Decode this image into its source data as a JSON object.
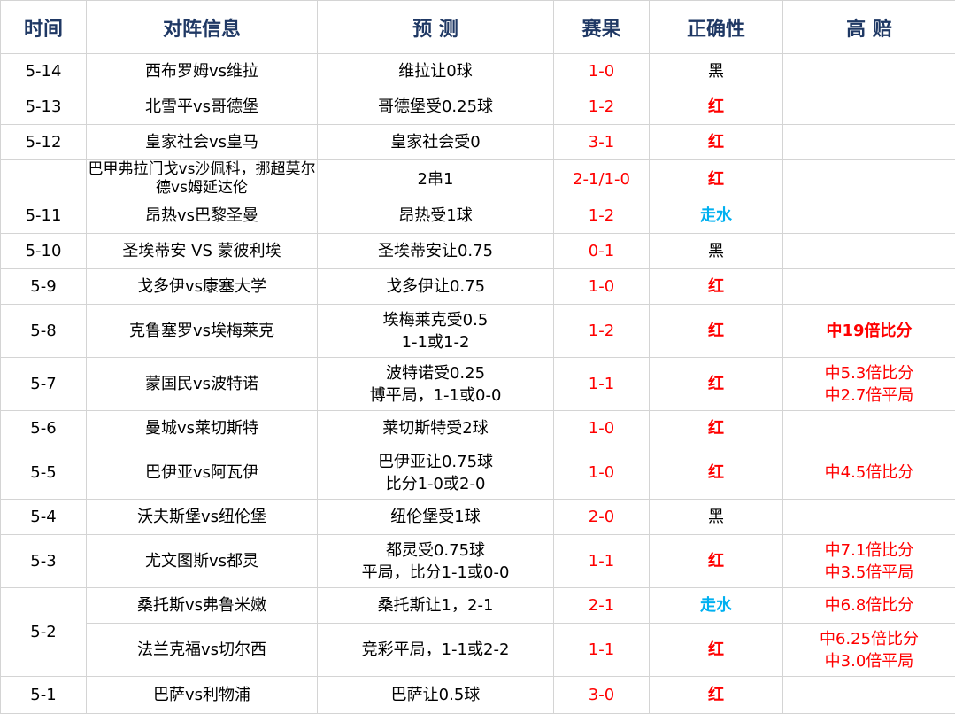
{
  "headers": {
    "time": "时间",
    "match": "对阵信息",
    "prediction": "预 测",
    "score": "赛果",
    "correctness": "正确性",
    "high_odds": "高 赔"
  },
  "rows": [
    {
      "date": "5-14",
      "match": "西布罗姆vs维拉",
      "prediction": [
        "维拉让0球"
      ],
      "score": "1-0",
      "result": "黑",
      "odds": []
    },
    {
      "date": "5-13",
      "match": "北雪平vs哥德堡",
      "prediction": [
        "哥德堡受0.25球"
      ],
      "score": "1-2",
      "result": "红",
      "odds": []
    },
    {
      "date": "5-12",
      "match": "皇家社会vs皇马",
      "prediction": [
        "皇家社会受0"
      ],
      "score": "3-1",
      "result": "红",
      "odds": []
    },
    {
      "date": "",
      "match": "巴甲弗拉门戈vs沙佩科，挪超莫尔德vs姆延达伦",
      "prediction": [
        "2串1"
      ],
      "score": "2-1/1-0",
      "result": "红",
      "odds": []
    },
    {
      "date": "5-11",
      "match": "昂热vs巴黎圣曼",
      "prediction": [
        "昂热受1球"
      ],
      "score": "1-2",
      "result": "走水",
      "odds": []
    },
    {
      "date": "5-10",
      "match": "圣埃蒂安 VS 蒙彼利埃",
      "prediction": [
        "圣埃蒂安让0.75"
      ],
      "score": "0-1",
      "result": "黑",
      "odds": []
    },
    {
      "date": "5-9",
      "match": "戈多伊vs康塞大学",
      "prediction": [
        "戈多伊让0.75"
      ],
      "score": "1-0",
      "result": "红",
      "odds": []
    },
    {
      "date": "5-8",
      "match": "克鲁塞罗vs埃梅莱克",
      "prediction": [
        "埃梅莱克受0.5",
        "1-1或1-2"
      ],
      "score": "1-2",
      "result": "红",
      "odds": [
        "中19倍比分"
      ],
      "odds_bold": true
    },
    {
      "date": "5-7",
      "match": "蒙国民vs波特诺",
      "prediction": [
        "波特诺受0.25",
        "博平局，1-1或0-0"
      ],
      "score": "1-1",
      "result": "红",
      "odds": [
        "中5.3倍比分",
        "中2.7倍平局"
      ]
    },
    {
      "date": "5-6",
      "match": "曼城vs莱切斯特",
      "prediction": [
        "莱切斯特受2球"
      ],
      "score": "1-0",
      "result": "红",
      "odds": []
    },
    {
      "date": "5-5",
      "match": "巴伊亚vs阿瓦伊",
      "prediction": [
        "巴伊亚让0.75球",
        "比分1-0或2-0"
      ],
      "score": "1-0",
      "result": "红",
      "odds": [
        "中4.5倍比分"
      ]
    },
    {
      "date": "5-4",
      "match": "沃夫斯堡vs纽伦堡",
      "prediction": [
        "纽伦堡受1球"
      ],
      "score": "2-0",
      "result": "黑",
      "odds": []
    },
    {
      "date": "5-3",
      "match": "尤文图斯vs都灵",
      "prediction": [
        "都灵受0.75球",
        "平局，比分1-1或0-0"
      ],
      "score": "1-1",
      "result": "红",
      "odds": [
        "中7.1倍比分",
        "中3.5倍平局"
      ]
    },
    {
      "date": "5-2",
      "match": "桑托斯vs弗鲁米嫩",
      "prediction": [
        "桑托斯让1，2-1"
      ],
      "score": "2-1",
      "result": "走水",
      "odds": [
        "中6.8倍比分"
      ]
    },
    {
      "date": "",
      "match": "法兰克福vs切尔西",
      "prediction": [
        "竞彩平局，1-1或2-2"
      ],
      "score": "1-1",
      "result": "红",
      "odds": [
        "中6.25倍比分",
        "中3.0倍平局"
      ]
    },
    {
      "date": "5-1",
      "match": "巴萨vs利物浦",
      "prediction": [
        "巴萨让0.5球"
      ],
      "score": "3-0",
      "result": "红",
      "odds": []
    }
  ]
}
